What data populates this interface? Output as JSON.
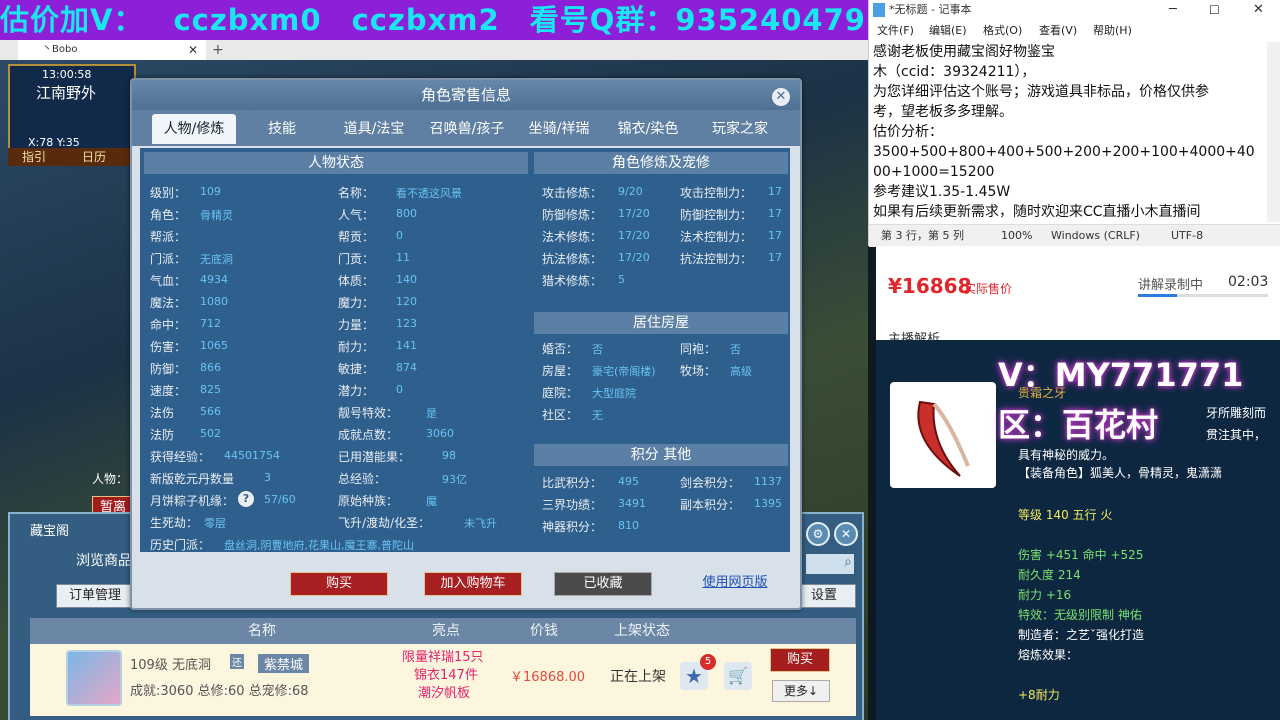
{
  "banner": {
    "segments": [
      "估价加V：",
      "cczbxm0",
      "cczbxm2",
      "看号Q群：935240479"
    ]
  },
  "game_window": {
    "tab_title": "丶Bobo",
    "minimap": {
      "time": "13:00:58",
      "place": "江南野外",
      "coords": "X:78  Y:35",
      "buttons": [
        "指引",
        "日历"
      ]
    },
    "left_panel": {
      "people_label": "人物：",
      "pause_button": "暂离"
    }
  },
  "trade_panel": {
    "title": "藏宝阁",
    "browse_label": "浏览商品",
    "order_button": "订单管理",
    "settings_button": "设置",
    "columns": [
      "名称",
      "亮点",
      "价钱",
      "上架状态"
    ],
    "row": {
      "level_school": "109级  无底洞",
      "tag_icon": "还",
      "server": "紫禁城",
      "achievements": "成就:3060  总修:60  总宠修:68",
      "highlights": [
        "限量祥瑞15只",
        "锦衣147件",
        "潮汐帆板"
      ],
      "price": "￥16868.00",
      "status": "正在上架",
      "fav_count": "5",
      "buy_button": "购买",
      "more_button": "更多↓"
    }
  },
  "dialog": {
    "title": "角色寄售信息",
    "tabs": [
      "人物/修炼",
      "技能",
      "道具/法宝",
      "召唤兽/孩子",
      "坐骑/祥瑞",
      "锦衣/染色",
      "玩家之家"
    ],
    "status_header": "人物状态",
    "status_left": [
      {
        "label": "级别：",
        "value": "109"
      },
      {
        "label": "角色：",
        "value": "骨精灵"
      },
      {
        "label": "帮派：",
        "value": ""
      },
      {
        "label": "门派：",
        "value": "无底洞"
      },
      {
        "label": "气血：",
        "value": "4934"
      },
      {
        "label": "魔法：",
        "value": "1080"
      },
      {
        "label": "命中：",
        "value": "712"
      },
      {
        "label": "伤害：",
        "value": "1065"
      },
      {
        "label": "防御：",
        "value": "866"
      },
      {
        "label": "速度：",
        "value": "825"
      },
      {
        "label": "法伤",
        "value": "566"
      },
      {
        "label": "法防",
        "value": "502"
      }
    ],
    "status_right": [
      {
        "label": "名称：",
        "value": "看不透这风景"
      },
      {
        "label": "人气：",
        "value": "800"
      },
      {
        "label": "帮贡：",
        "value": "0"
      },
      {
        "label": "门贡：",
        "value": "11"
      },
      {
        "label": "体质：",
        "value": "140"
      },
      {
        "label": "魔力：",
        "value": "120"
      },
      {
        "label": "力量：",
        "value": "123"
      },
      {
        "label": "耐力：",
        "value": "141"
      },
      {
        "label": "敏捷：",
        "value": "874"
      },
      {
        "label": "潜力：",
        "value": "0"
      },
      {
        "label": "靓号特效：",
        "value": "是"
      },
      {
        "label": "成就点数：",
        "value": "3060"
      }
    ],
    "extra_left": [
      {
        "label": "获得经验：",
        "value": "44501754"
      },
      {
        "label": "新版乾元丹数量",
        "value": "3"
      },
      {
        "label": "月饼粽子机缘：",
        "value": "57/60"
      },
      {
        "label": "生死劫：",
        "value": "零层"
      },
      {
        "label": "历史门派：",
        "value": "盘丝洞,阴曹地府,花果山,魔王寨,普陀山"
      }
    ],
    "extra_right": [
      {
        "label": "已用潜能果：",
        "value": "98"
      },
      {
        "label": "总经验：",
        "value": "93亿"
      },
      {
        "label": "原始种族：",
        "value": "魔"
      },
      {
        "label": "飞升/渡劫/化圣：",
        "value": "未飞升"
      }
    ],
    "cultivation_header": "角色修炼及宠修",
    "cultivation": [
      {
        "label": "攻击修炼：",
        "value": "9/20",
        "label2": "攻击控制力：",
        "value2": "17"
      },
      {
        "label": "防御修炼：",
        "value": "17/20",
        "label2": "防御控制力：",
        "value2": "17"
      },
      {
        "label": "法术修炼：",
        "value": "17/20",
        "label2": "法术控制力：",
        "value2": "17"
      },
      {
        "label": "抗法修炼：",
        "value": "17/20",
        "label2": "抗法控制力：",
        "value2": "17"
      },
      {
        "label": "猎术修炼：",
        "value": "5",
        "label2": "",
        "value2": ""
      }
    ],
    "house_header": "居住房屋",
    "house": [
      {
        "label": "婚否：",
        "value": "否",
        "label2": "同袍：",
        "value2": "否"
      },
      {
        "label": "房屋：",
        "value": "豪宅(帝阁楼)",
        "label2": "牧场：",
        "value2": "高级"
      },
      {
        "label": "庭院：",
        "value": "大型庭院",
        "label2": "",
        "value2": ""
      },
      {
        "label": "社区：",
        "value": "无",
        "label2": "",
        "value2": ""
      }
    ],
    "score_header": "积分 其他",
    "scores": [
      {
        "label": "比武积分：",
        "value": "495",
        "label2": "剑会积分：",
        "value2": "1137"
      },
      {
        "label": "三界功绩：",
        "value": "3491",
        "label2": "副本积分：",
        "value2": "1395"
      },
      {
        "label": "神器积分：",
        "value": "810",
        "label2": "",
        "value2": ""
      }
    ],
    "buttons": {
      "buy": "购买",
      "add_cart": "加入购物车",
      "collected": "已收藏",
      "web": "使用网页版"
    }
  },
  "notepad": {
    "title": "*无标题 - 记事本",
    "menu": [
      "文件(F)",
      "编辑(E)",
      "格式(O)",
      "查看(V)",
      "帮助(H)"
    ],
    "lines": [
      "感谢老板使用藏宝阁好物鉴宝",
      "木（ccid：39324211），",
      "为您详细评估这个账号；游戏道具非标品，价格仅供参",
      "考，望老板多多理解。",
      "估价分析：",
      "3500+500+800+400+500+200+200+100+4000+40",
      "00+1000=15200",
      "参考建议1.35-1.45W",
      "如果有后续更新需求，随时欢迎来CC直播小木直播间"
    ],
    "status": {
      "pos": "第 3 行，第 5 列",
      "zoom": "100%",
      "eol": "Windows (CRLF)",
      "enc": "UTF-8"
    }
  },
  "price_panel": {
    "price": "¥16868",
    "price_label": "实际售价",
    "recording": "讲解录制中",
    "time": "02:03",
    "section": "主播解析"
  },
  "overlay": {
    "wechat": "V：MY771771",
    "district": "区：百花村"
  },
  "item": {
    "name": "贵霜之牙",
    "desc_line": "牙所雕刻而",
    "desc2": "贯注其中，",
    "desc3": "具有神秘的威力。",
    "equip_role": "【装备角色】狐美人，骨精灵，鬼潇潇",
    "level": "等级 140 五行 火",
    "attack": "伤害 +451 命中 +525",
    "durability": "耐久度 214",
    "stamina": "耐力 +16",
    "special": "特效：无级别限制 神佑",
    "maker": "制造者：之艺ˇ强化打造",
    "smelt": "熔炼效果：",
    "smelt_val": "+8耐力"
  }
}
